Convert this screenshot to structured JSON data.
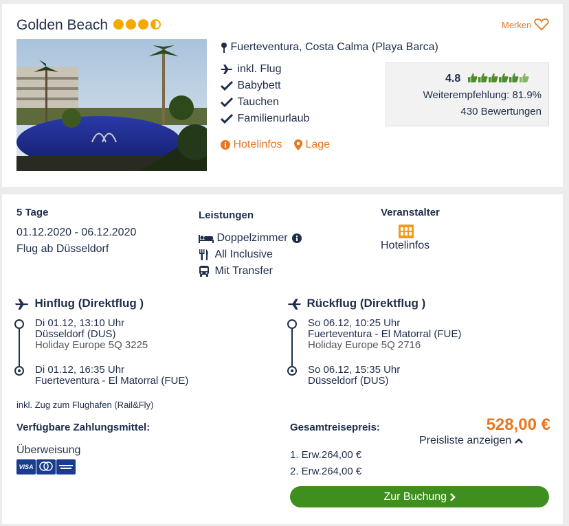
{
  "hotel": {
    "name": "Golden Beach",
    "stars": 3.5,
    "location": "Fuerteventura, Costa Calma (Playa Barca)",
    "merken_label": "Merken",
    "features": [
      "inkl. Flug",
      "Babybett",
      "Tauchen",
      "Familienurlaub"
    ],
    "links": {
      "hotelinfos": "Hotelinfos",
      "lage": "Lage"
    },
    "rating": {
      "score": "4.8",
      "thumbs": 6,
      "recommendation": "Weiterempfehlung: 81.9%",
      "reviews": "430 Bewertungen"
    }
  },
  "trip": {
    "duration": "5 Tage",
    "dates": "01.12.2020 - 06.12.2020",
    "departure": "Flug ab Düsseldorf",
    "services_title": "Leistungen",
    "services": [
      "Doppelzimmer",
      "All Inclusive",
      "Mit Transfer"
    ],
    "operator_title": "Veranstalter",
    "operator_link": "Hotelinfos"
  },
  "outbound": {
    "title": "Hinflug (Direktflug )",
    "dep_time": "Di 01.12, 13:10 Uhr",
    "dep_airport": "Düsseldorf (DUS)",
    "airline": "Holiday Europe 5Q 3225",
    "arr_time": "Di 01.12, 16:35 Uhr",
    "arr_airport": "Fuerteventura - El Matorral (FUE)"
  },
  "return": {
    "title": "Rückflug (Direktflug )",
    "dep_time": "So 06.12, 10:25 Uhr",
    "dep_airport": "Fuerteventura - El Matorral (FUE)",
    "airline": "Holiday Europe 5Q 2716",
    "arr_time": "So 06.12, 15:35 Uhr",
    "arr_airport": "Düsseldorf (DUS)"
  },
  "rail_fly_note": "inkl. Zug zum Flughafen (Rail&Fly)",
  "payment": {
    "title": "Verfügbare Zahlungsmittel:",
    "method": "Überweisung",
    "cards": [
      "VISA",
      "Mastercard",
      "American Express"
    ]
  },
  "price": {
    "title": "Gesamtreisepreis:",
    "total": "528,00 €",
    "pricelist_label": "Preisliste anzeigen",
    "lines": [
      "1. Erw.264,00 €",
      "2. Erw.264,00 €"
    ],
    "book_label": "Zur Buchung"
  },
  "colors": {
    "navy": "#1e2d4a",
    "orange": "#e87722",
    "green": "#3f8f1f",
    "star": "#f5a800"
  }
}
